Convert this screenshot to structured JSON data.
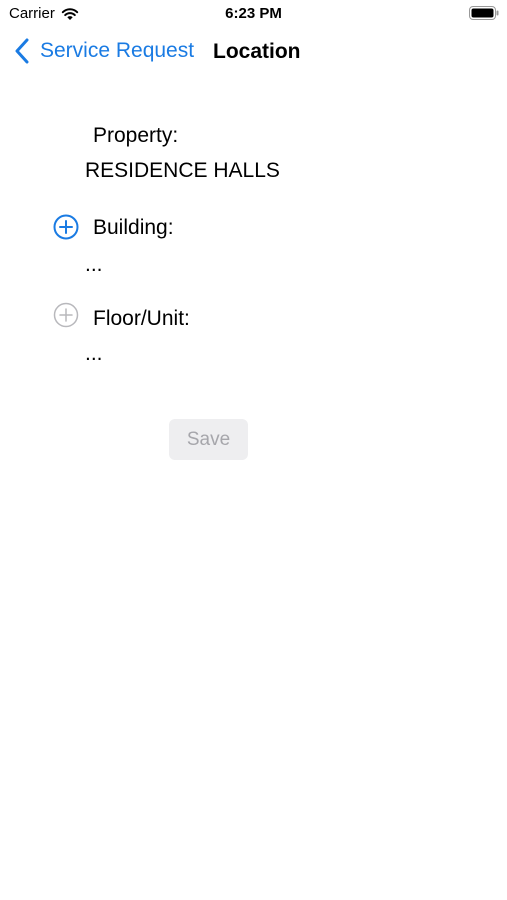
{
  "status_bar": {
    "carrier": "Carrier",
    "time": "6:23 PM"
  },
  "nav": {
    "back_label": "Service Request",
    "title": "Location"
  },
  "fields": {
    "property": {
      "label": "Property:",
      "value": "RESIDENCE HALLS"
    },
    "building": {
      "label": "Building:",
      "value": "..."
    },
    "floor_unit": {
      "label": "Floor/Unit:",
      "value": "..."
    }
  },
  "actions": {
    "save_label": "Save"
  },
  "colors": {
    "accent": "#1a7be3",
    "disabled_icon": "#b8b8bc",
    "button_bg": "#eeeef0",
    "button_text_disabled": "#a6a6ab"
  },
  "icons": [
    "wifi-icon",
    "battery-icon",
    "chevron-left-icon",
    "plus-circle-icon"
  ]
}
